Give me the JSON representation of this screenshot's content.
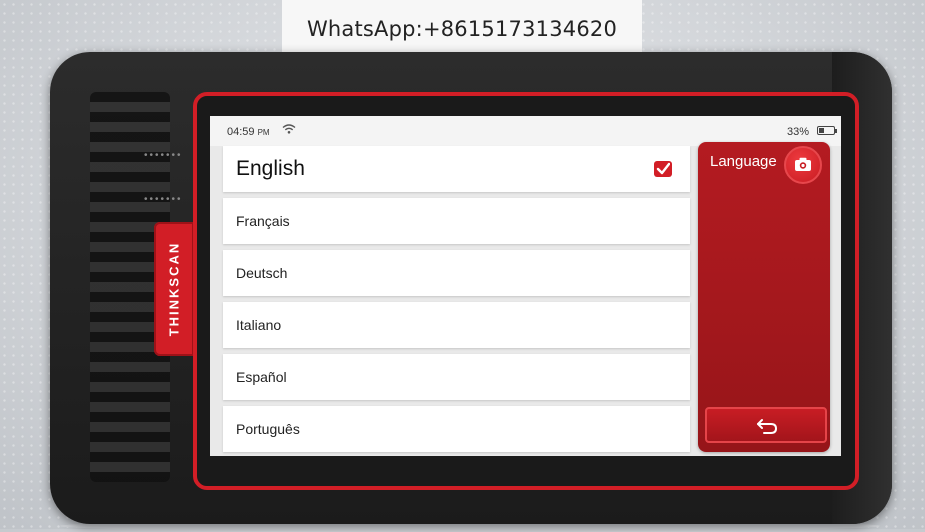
{
  "watermark": {
    "text": "WhatsApp:+8615173134620"
  },
  "device": {
    "brand": "THINKSCAN"
  },
  "status_bar": {
    "time": "04:59",
    "ampm": "PM",
    "battery_percent": "33%",
    "battery_level": 0.33,
    "wifi_icon": "wifi-icon"
  },
  "languages": [
    {
      "label": "English",
      "selected": true
    },
    {
      "label": "Français",
      "selected": false
    },
    {
      "label": "Deutsch",
      "selected": false
    },
    {
      "label": "Italiano",
      "selected": false
    },
    {
      "label": "Español",
      "selected": false
    },
    {
      "label": "Português",
      "selected": false
    }
  ],
  "side_panel": {
    "title": "Language",
    "camera_icon": "camera-icon",
    "back_icon": "back-arrow-icon"
  },
  "colors": {
    "accent": "#d21e26",
    "panel": "#b41b21"
  }
}
